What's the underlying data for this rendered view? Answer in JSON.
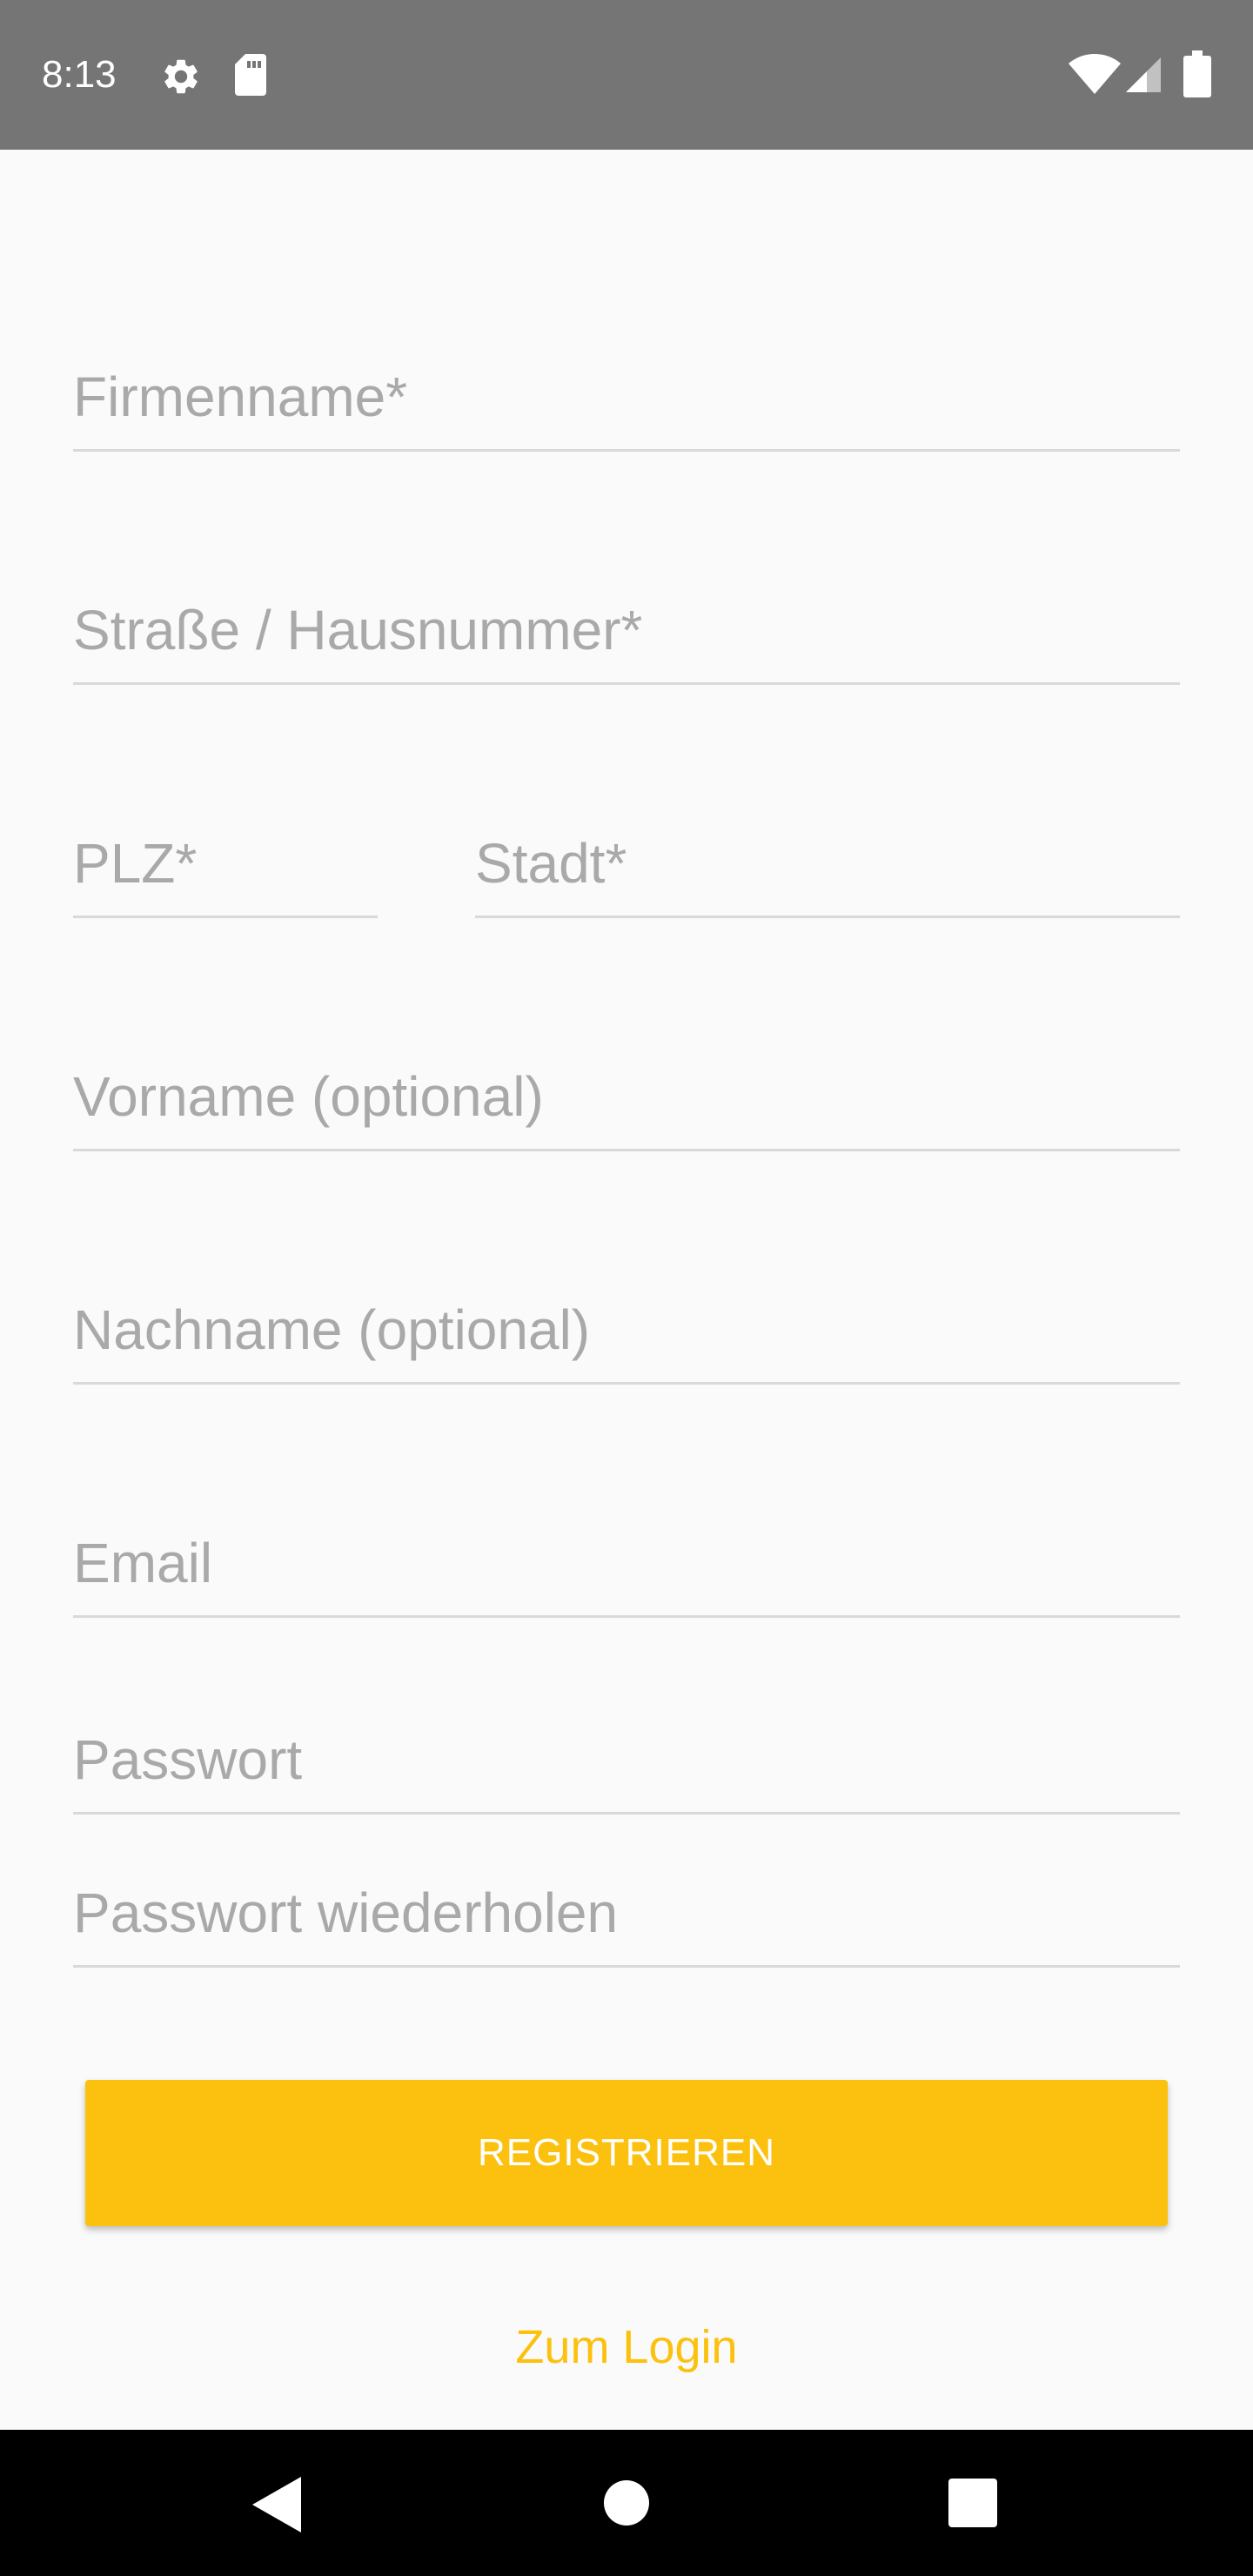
{
  "status_bar": {
    "time": "8:13",
    "icons": [
      "gear-icon",
      "sdcard-icon",
      "wifi-icon",
      "signal-icon",
      "battery-icon"
    ]
  },
  "form": {
    "company_name": {
      "placeholder": "Firmenname*",
      "value": ""
    },
    "street": {
      "placeholder": "Straße / Hausnummer*",
      "value": ""
    },
    "zip": {
      "placeholder": "PLZ*",
      "value": ""
    },
    "city": {
      "placeholder": "Stadt*",
      "value": ""
    },
    "first_name": {
      "placeholder": "Vorname (optional)",
      "value": ""
    },
    "last_name": {
      "placeholder": "Nachname (optional)",
      "value": ""
    },
    "email": {
      "placeholder": "Email",
      "value": ""
    },
    "password": {
      "placeholder": "Passwort",
      "value": ""
    },
    "password_repeat": {
      "placeholder": "Passwort wiederholen",
      "value": ""
    }
  },
  "actions": {
    "register_label": "REGISTRIEREN",
    "login_label": "Zum Login"
  },
  "nav_bar": {
    "icons": [
      "back-icon",
      "home-icon",
      "recent-apps-icon"
    ]
  },
  "colors": {
    "accent": "#fbc10e",
    "status_bar": "#757575",
    "background": "#fafafa",
    "placeholder": "#a9a9a9",
    "underline": "#d9d9d9"
  }
}
